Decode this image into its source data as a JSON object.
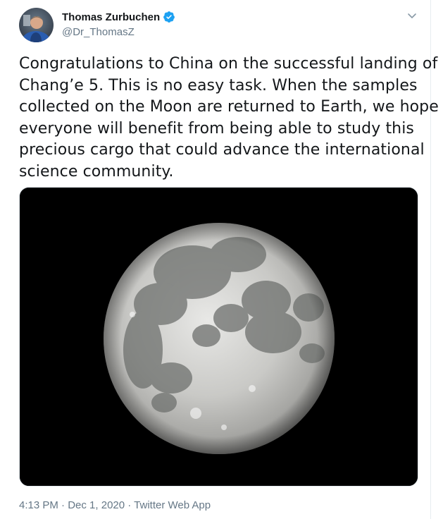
{
  "author": {
    "name": "Thomas Zurbuchen",
    "handle": "@Dr_ThomasZ",
    "verified": true
  },
  "tweet": {
    "lines": [
      "Congratulations to China on the successful landing of",
      "Chang’e 5. This is no easy task. When the samples",
      "collected on the Moon are returned to Earth, we hope",
      "everyone will benefit from being able to study this",
      "precious cargo that could advance the international",
      "science community."
    ]
  },
  "meta": {
    "time": "4:13 PM",
    "sep1": " · ",
    "date": "Dec 1, 2020",
    "sep2": " · ",
    "source": "Twitter Web App"
  },
  "icons": {
    "verified": "verified-badge-icon",
    "caret": "chevron-down-icon"
  },
  "colors": {
    "accent": "#1da1f2",
    "text": "#14171a",
    "secondary": "#657786"
  }
}
